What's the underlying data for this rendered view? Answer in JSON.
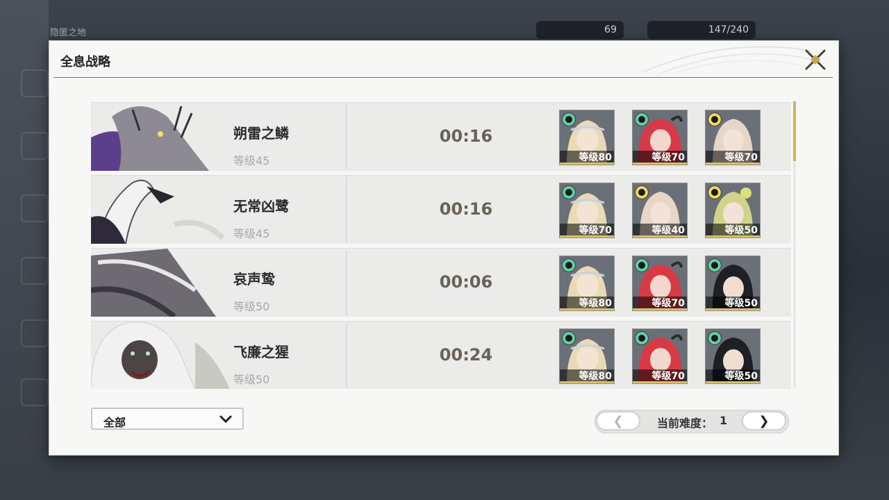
{
  "hud": {
    "location": "隐匿之地",
    "currency_value": "69",
    "stamina": "147/240"
  },
  "dialog": {
    "title": "全息战略"
  },
  "records": [
    {
      "boss_name": "朔雷之鳞",
      "boss_level": "等级45",
      "time": "00:16",
      "team": [
        {
          "level": "等级80",
          "element": "aero"
        },
        {
          "level": "等级70",
          "element": "aero"
        },
        {
          "level": "等级70",
          "element": "spectro"
        }
      ]
    },
    {
      "boss_name": "无常凶鹭",
      "boss_level": "等级45",
      "time": "00:16",
      "team": [
        {
          "level": "等级70",
          "element": "aero"
        },
        {
          "level": "等级40",
          "element": "spectro"
        },
        {
          "level": "等级50",
          "element": "spectro"
        }
      ]
    },
    {
      "boss_name": "哀声鸷",
      "boss_level": "等级50",
      "time": "00:06",
      "team": [
        {
          "level": "等级80",
          "element": "aero"
        },
        {
          "level": "等级70",
          "element": "aero"
        },
        {
          "level": "等级50",
          "element": "aero"
        }
      ]
    },
    {
      "boss_name": "飞廉之猩",
      "boss_level": "等级50",
      "time": "00:24",
      "team": [
        {
          "level": "等级80",
          "element": "aero"
        },
        {
          "level": "等级70",
          "element": "aero"
        },
        {
          "level": "等级50",
          "element": "aero"
        }
      ]
    }
  ],
  "filter": {
    "selected": "全部"
  },
  "pager": {
    "label": "当前难度：",
    "value": "1",
    "prev": "❮",
    "next": "❯"
  },
  "scroll": {
    "position": 0
  },
  "colors": {
    "accent_gold": "#d7c068",
    "title_line": "#8a3a3a",
    "time_text": "#6a6256"
  }
}
